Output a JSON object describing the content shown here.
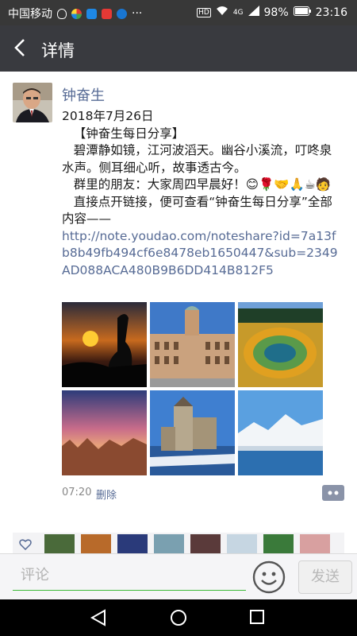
{
  "status_bar": {
    "carrier": "中国移动",
    "more": "···",
    "hd": "HD",
    "network": "4G",
    "battery": "98%",
    "time": "23:16"
  },
  "nav": {
    "title": "详情"
  },
  "post": {
    "author": "钟奋生",
    "text_date": "2018年7月26日",
    "text_tag": "   【钟奋生每日分享】",
    "text_p1": "   碧潭静如镜，江河波滔天。幽谷小溪流，叮咚泉水声。侧耳细心听，故事透古今。",
    "text_p2": "   群里的朋友：大家周四早晨好！😊🌹🤝🙏☕🧑",
    "text_p3": "   直接点开链接，便可查看“钟奋生每日分享”全部内容——",
    "link": "http://note.youdao.com/noteshare?id=7a13fb8b49fb494cf6e8478eb1650447&sub=2349AD088ACA480B9B6DD414B812F5",
    "time": "07:20",
    "delete_label": "删除",
    "photos": [
      "sunset-crane",
      "classical-building",
      "hot-spring",
      "canyon-sunset",
      "castle",
      "snow-mountain-lake"
    ]
  },
  "comment": {
    "placeholder": "评论",
    "send_label": "发送"
  },
  "colors": {
    "link": "#576b95",
    "accent_green": "#3dbb3a",
    "nav_bg": "#393a3f"
  }
}
